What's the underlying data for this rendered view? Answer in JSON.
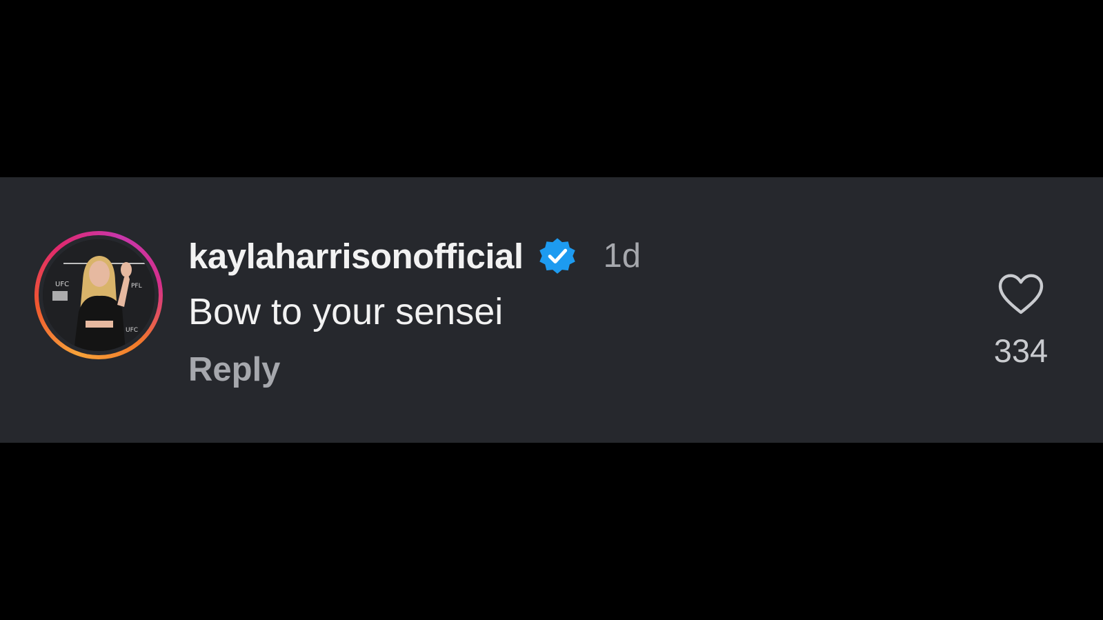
{
  "comment": {
    "username": "kaylaharrisonofficial",
    "verified": true,
    "time": "1d",
    "text": "Bow to your sensei",
    "reply_label": "Reply",
    "like_count": "334"
  },
  "icons": {
    "verified": "verified-badge-icon",
    "like": "heart-outline-icon"
  },
  "colors": {
    "card_background": "#26282d",
    "page_background": "#000000",
    "verified_blue": "#1d9bf0",
    "secondary_text": "#a6a8ad"
  }
}
